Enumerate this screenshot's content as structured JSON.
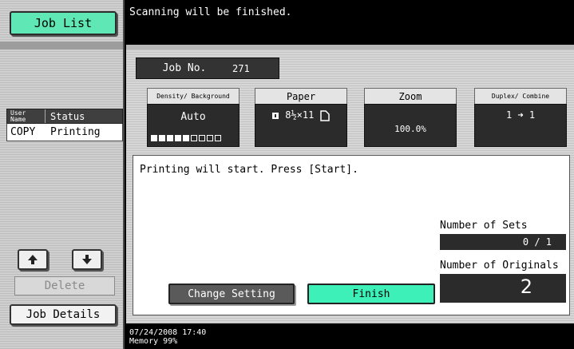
{
  "sidebar": {
    "job_list_label": "Job List",
    "table": {
      "col_user_name": "User Name",
      "col_status": "Status",
      "rows": [
        {
          "user": "COPY",
          "status": "Printing"
        }
      ]
    },
    "up_icon": "up-arrow-icon",
    "down_icon": "down-arrow-icon",
    "delete_label": "Delete",
    "job_details_label": "Job Details"
  },
  "message": "Scanning will be finished.",
  "job": {
    "label": "Job No.",
    "number": "271"
  },
  "settings": {
    "density": {
      "header": "Density/ Background",
      "value": "Auto",
      "level": 5,
      "levels": 9
    },
    "paper": {
      "header": "Paper",
      "value": "8½×11"
    },
    "zoom": {
      "header": "Zoom",
      "value": "100.0%"
    },
    "duplex": {
      "header": "Duplex/ Combine",
      "value": "1 ➜ 1"
    }
  },
  "instruction": "Printing will start. Press [Start].",
  "sets": {
    "label": "Number of Sets",
    "value": "0 / 1"
  },
  "originals": {
    "label": "Number of Originals",
    "value": "2"
  },
  "buttons": {
    "change_setting": "Change Setting",
    "finish": "Finish"
  },
  "footer": {
    "datetime": "07/24/2008   17:40",
    "memory": "Memory       99%"
  },
  "colors": {
    "accent": "#3df0b8",
    "dark": "#2b2b2b"
  }
}
